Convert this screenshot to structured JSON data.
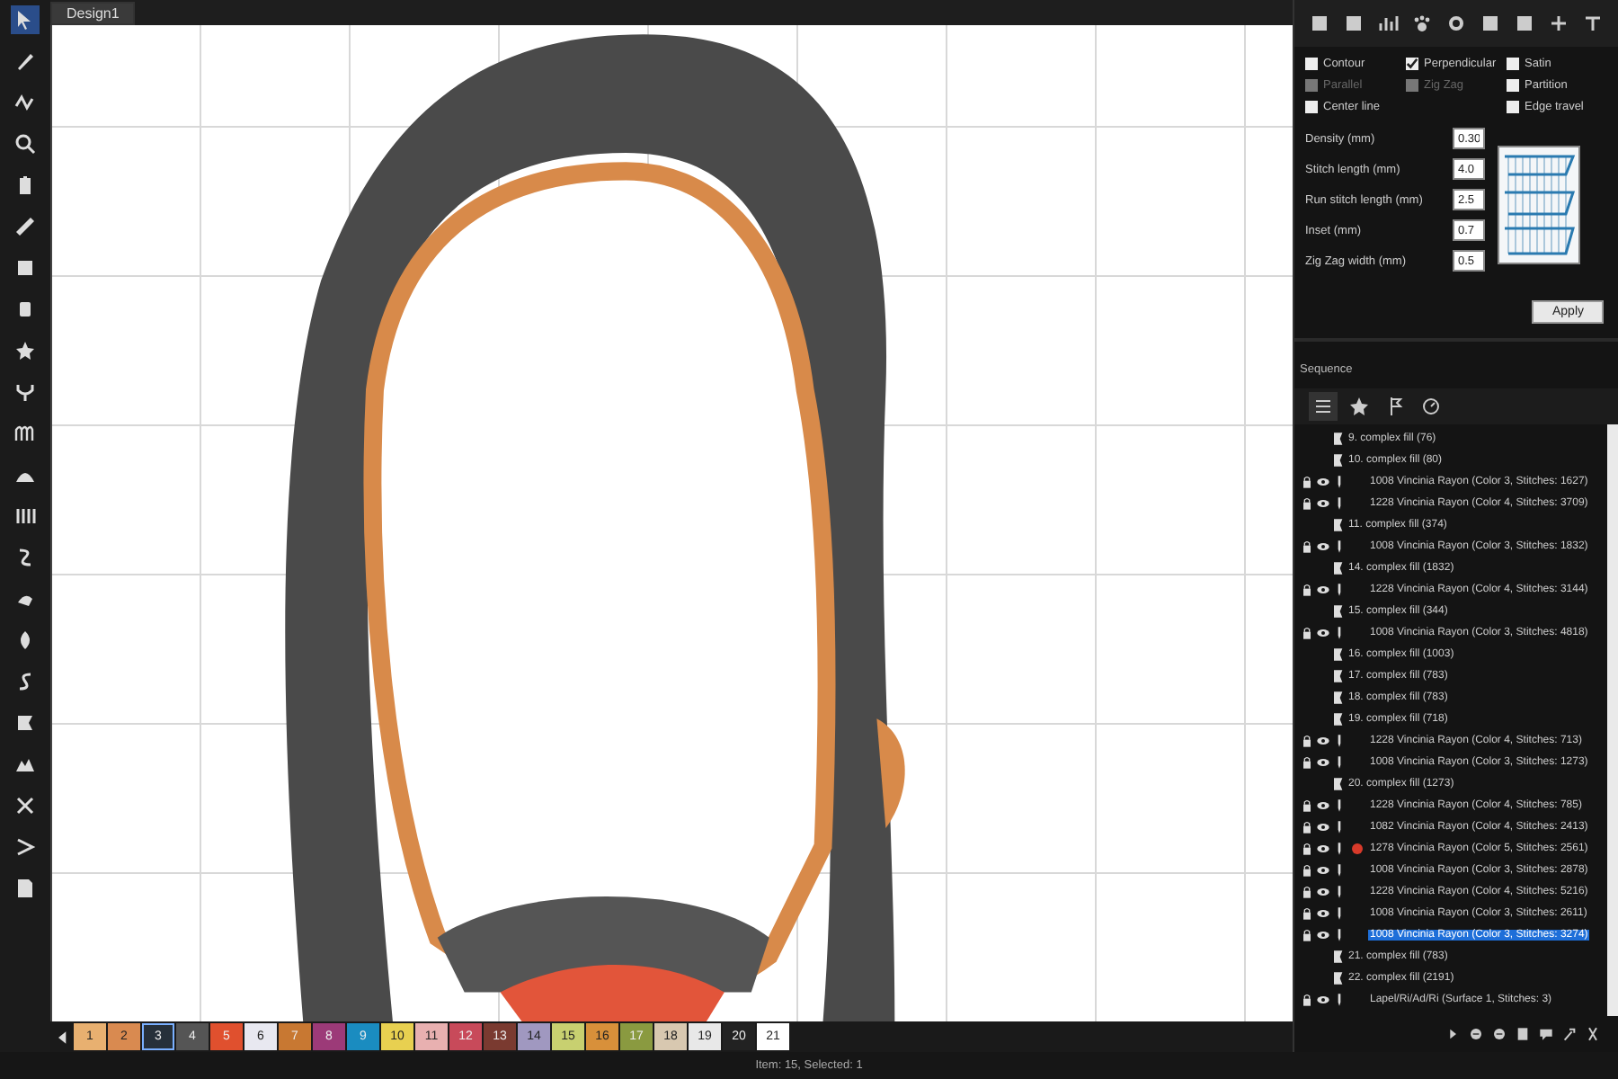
{
  "document_tab": {
    "title": "Design1",
    "selected": true
  },
  "stitch_panel": {
    "option_rows": [
      [
        {
          "label": "Contour",
          "checked": false,
          "disabled": false
        },
        {
          "label": "Perpendicular",
          "checked": true,
          "disabled": false
        },
        {
          "label": "Satin",
          "checked": false,
          "disabled": false
        }
      ],
      [
        {
          "label": "Parallel",
          "checked": false,
          "disabled": true
        },
        {
          "label": "Zig Zag",
          "checked": false,
          "disabled": true
        },
        {
          "label": "Partition",
          "checked": false,
          "disabled": false
        }
      ],
      [
        {
          "label": "Center line",
          "checked": false,
          "disabled": false
        },
        {
          "label": "Edge travel",
          "checked": false,
          "disabled": false
        }
      ]
    ],
    "fields": [
      {
        "label": "Density (mm)",
        "value": "0.30"
      },
      {
        "label": "Stitch length (mm)",
        "value": "4.0"
      },
      {
        "label": "Run stitch length (mm)",
        "value": "2.5"
      },
      {
        "label": "Inset (mm)",
        "value": "0.7"
      },
      {
        "label": "Zig Zag width (mm)",
        "value": "0.5"
      }
    ],
    "apply_button": "Apply"
  },
  "sequence": {
    "title": "Sequence",
    "items": [
      {
        "kind": "object",
        "label": "9. complex fill (76)",
        "selected": false
      },
      {
        "kind": "object",
        "label": "10. complex fill (80)",
        "selected": false
      },
      {
        "kind": "color",
        "label": "1008 Vincinia Rayon (Color 3, Stitches: 1627)",
        "selected": false
      },
      {
        "kind": "color",
        "label": "1228 Vincinia Rayon (Color 4, Stitches: 3709)",
        "selected": false,
        "children": [
          {
            "kind": "object",
            "label": "11. complex fill (374)",
            "selected": false
          }
        ]
      },
      {
        "kind": "color",
        "label": "1008 Vincinia Rayon (Color 3, Stitches: 1832)",
        "selected": false,
        "children": [
          {
            "kind": "object",
            "label": "14. complex fill (1832)",
            "selected": false
          }
        ]
      },
      {
        "kind": "color",
        "label": "1228 Vincinia Rayon (Color 4, Stitches: 3144)",
        "selected": false,
        "children": [
          {
            "kind": "object",
            "label": "15. complex fill (344)",
            "selected": false
          }
        ]
      },
      {
        "kind": "color",
        "label": "1008 Vincinia Rayon (Color 3, Stitches: 4818)",
        "selected": false,
        "children": [
          {
            "kind": "object",
            "label": "16. complex fill (1003)",
            "selected": false
          },
          {
            "kind": "object",
            "label": "17. complex fill (783)",
            "selected": false
          },
          {
            "kind": "object",
            "label": "18. complex fill (783)",
            "selected": false
          },
          {
            "kind": "object",
            "label": "19. complex fill (718)",
            "selected": false
          }
        ]
      },
      {
        "kind": "color",
        "label": "1228 Vincinia Rayon (Color 4, Stitches: 713)",
        "selected": false
      },
      {
        "kind": "color",
        "label": "1008 Vincinia Rayon (Color 3, Stitches: 1273)",
        "selected": false,
        "children": [
          {
            "kind": "object",
            "label": "20. complex fill (1273)",
            "selected": false
          }
        ]
      },
      {
        "kind": "color",
        "label": "1228 Vincinia Rayon (Color 4, Stitches: 785)",
        "selected": false
      },
      {
        "kind": "color",
        "label": "1082 Vincinia Rayon (Color 4, Stitches: 2413)",
        "selected": false
      },
      {
        "kind": "color",
        "label": "1278 Vincinia Rayon (Color 5, Stitches: 2561)",
        "selected": false,
        "color": "#d83a2a"
      },
      {
        "kind": "color",
        "label": "1008 Vincinia Rayon (Color 3, Stitches: 2878)",
        "selected": false
      },
      {
        "kind": "color",
        "label": "1228 Vincinia Rayon (Color 4, Stitches: 5216)",
        "selected": false
      },
      {
        "kind": "color",
        "label": "1008 Vincinia Rayon (Color 3, Stitches: 2611)",
        "selected": false
      },
      {
        "kind": "color",
        "label": "1008 Vincinia Rayon (Color 3, Stitches: 3274)",
        "selected": true,
        "children": [
          {
            "kind": "object",
            "label": "21. complex fill (783)",
            "selected": false
          },
          {
            "kind": "object",
            "label": "22. complex fill (2191)",
            "selected": false
          }
        ]
      },
      {
        "kind": "text",
        "label": "Lapel/Ri/Ad/Ri (Surface 1, Stitches: 3)",
        "selected": false
      }
    ]
  },
  "palette": [
    {
      "number": "1",
      "color": "#e8b070",
      "selected": false
    },
    {
      "number": "2",
      "color": "#d98a50",
      "selected": false
    },
    {
      "number": "3",
      "color": "#26303a",
      "selected": true
    },
    {
      "number": "4",
      "color": "#555555",
      "selected": false
    },
    {
      "number": "5",
      "color": "#e0502e",
      "selected": false
    },
    {
      "number": "6",
      "color": "#e8e8f0",
      "selected": false
    },
    {
      "number": "7",
      "color": "#c87832",
      "selected": false
    },
    {
      "number": "8",
      "color": "#9c3a78",
      "selected": false
    },
    {
      "number": "9",
      "color": "#1a8cc0",
      "selected": false
    },
    {
      "number": "10",
      "color": "#e8d050",
      "selected": false
    },
    {
      "number": "11",
      "color": "#e8b0b0",
      "selected": false
    },
    {
      "number": "12",
      "color": "#c84a5a",
      "selected": false
    },
    {
      "number": "13",
      "color": "#7a3a30",
      "selected": false
    },
    {
      "number": "14",
      "color": "#a098c0",
      "selected": false
    },
    {
      "number": "15",
      "color": "#c8d070",
      "selected": false
    },
    {
      "number": "16",
      "color": "#d8903a",
      "selected": false
    },
    {
      "number": "17",
      "color": "#8a9a40",
      "selected": false
    },
    {
      "number": "18",
      "color": "#d8c8b0",
      "selected": false
    },
    {
      "number": "19",
      "color": "#e8e8e8",
      "selected": false
    },
    {
      "number": "20",
      "color": "#222222",
      "selected": false
    },
    {
      "number": "21",
      "color": "#ffffff",
      "selected": false
    }
  ],
  "status_bar": "Item: 15, Selected: 1"
}
